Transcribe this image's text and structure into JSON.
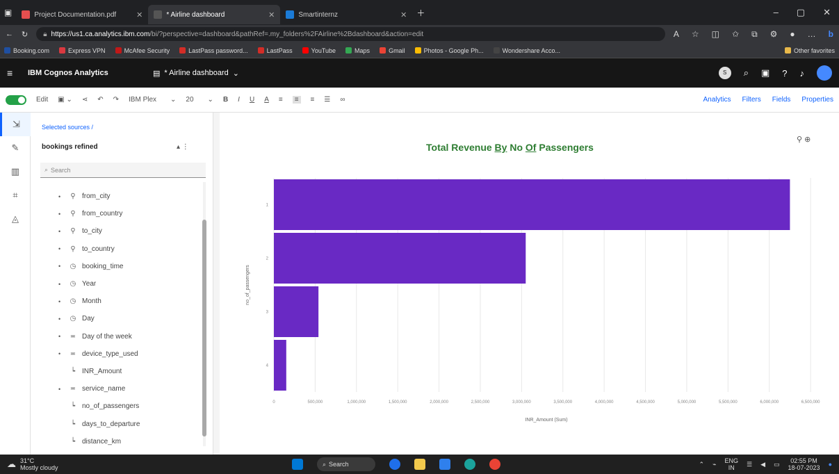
{
  "browser": {
    "tabs": [
      {
        "title": "Project Documentation.pdf",
        "color": "#e34f4f",
        "active": false
      },
      {
        "title": "* Airline dashboard",
        "color": "#555555",
        "active": true
      },
      {
        "title": "Smartinternz",
        "color": "#1b7bd6",
        "active": false
      }
    ],
    "url_host": "https://us1.ca.analytics.ibm.com",
    "url_rest": "/bi/?perspective=dashboard&pathRef=.my_folders%2FAirline%2Bdashboard&action=edit",
    "bookmarks": [
      "Booking.com",
      "Express VPN",
      "McAfee Security",
      "LastPass password...",
      "LastPass",
      "YouTube",
      "Maps",
      "Gmail",
      "Photos - Google Ph...",
      "Wondershare Acco..."
    ],
    "other_favorites": "Other favorites"
  },
  "app": {
    "name": "IBM Cognos Analytics",
    "dashboard_title": "* Airline dashboard",
    "user_initials": "S"
  },
  "toolbar": {
    "edit_label": "Edit",
    "font_name": "IBM Plex",
    "font_size": "20",
    "analytics": "Analytics",
    "filters": "Filters",
    "fields": "Fields",
    "properties": "Properties"
  },
  "panel": {
    "breadcrumb": "Selected sources /",
    "source_name": "bookings refined",
    "search_placeholder": "Search",
    "fields": [
      {
        "name": "from_city",
        "icon": "location-icon",
        "glyph": "⚲",
        "measure": false
      },
      {
        "name": "from_country",
        "icon": "location-icon",
        "glyph": "⚲",
        "measure": false
      },
      {
        "name": "to_city",
        "icon": "location-icon",
        "glyph": "⚲",
        "measure": false
      },
      {
        "name": "to_country",
        "icon": "location-icon",
        "glyph": "⚲",
        "measure": false
      },
      {
        "name": "booking_time",
        "icon": "clock-icon",
        "glyph": "◷",
        "measure": false
      },
      {
        "name": "Year",
        "icon": "clock-icon",
        "glyph": "◷",
        "measure": false
      },
      {
        "name": "Month",
        "icon": "clock-icon",
        "glyph": "◷",
        "measure": false
      },
      {
        "name": "Day",
        "icon": "clock-icon",
        "glyph": "◷",
        "measure": false
      },
      {
        "name": "Day of the week",
        "icon": "text-icon",
        "glyph": "≖",
        "measure": false
      },
      {
        "name": "device_type_used",
        "icon": "text-icon",
        "glyph": "≖",
        "measure": false
      },
      {
        "name": "INR_Amount",
        "icon": "measure-icon",
        "glyph": "┕",
        "measure": true
      },
      {
        "name": "service_name",
        "icon": "text-icon",
        "glyph": "≖",
        "measure": false
      },
      {
        "name": "no_of_passengers",
        "icon": "measure-icon",
        "glyph": "┕",
        "measure": true
      },
      {
        "name": "days_to_departure",
        "icon": "measure-icon",
        "glyph": "┕",
        "measure": true
      },
      {
        "name": "distance_km",
        "icon": "measure-icon",
        "glyph": "┕",
        "measure": true
      }
    ]
  },
  "chart_data": {
    "type": "bar",
    "orientation": "horizontal",
    "title_parts": [
      {
        "text": "Total Revenue ",
        "u": false
      },
      {
        "text": "By",
        "u": true
      },
      {
        "text": " No ",
        "u": false
      },
      {
        "text": "Of",
        "u": true
      },
      {
        "text": " Passengers",
        "u": false
      }
    ],
    "bar_color": "#6929c4",
    "categories": [
      "1",
      "2",
      "3",
      "4"
    ],
    "values": [
      6250000,
      3050000,
      540000,
      150000
    ],
    "xlim": [
      0,
      6600000
    ],
    "x_ticks": [
      0,
      500000,
      1000000,
      1500000,
      2000000,
      2500000,
      3000000,
      3500000,
      4000000,
      4500000,
      5000000,
      5500000,
      6000000,
      6500000
    ],
    "x_tick_labels": [
      "0",
      "500,000",
      "1,000,000",
      "1,500,000",
      "2,000,000",
      "2,500,000",
      "3,000,000",
      "3,500,000",
      "4,000,000",
      "4,500,000",
      "5,000,000",
      "5,500,000",
      "6,000,000",
      "6,500,000"
    ],
    "xlabel": "INR_Amount (Sum)",
    "ylabel": "no_of_passengers",
    "grid": true
  },
  "taskbar": {
    "temp": "31°C",
    "weather": "Mostly cloudy",
    "search": "Search",
    "lang": "ENG",
    "region": "IN",
    "time": "02:55 PM",
    "date": "18-07-2023"
  }
}
